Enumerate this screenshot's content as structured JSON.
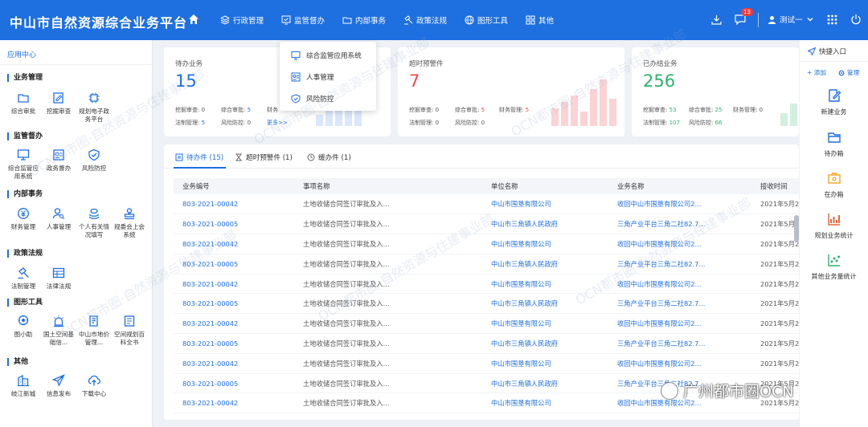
{
  "app": {
    "title": "中山市自然资源综合业务平台"
  },
  "nav": [
    {
      "label": "行政管理",
      "icon": "layers-icon"
    },
    {
      "label": "监管督办",
      "icon": "monitor-check-icon"
    },
    {
      "label": "内部事务",
      "icon": "folder-icon"
    },
    {
      "label": "政策法规",
      "icon": "gavel-icon"
    },
    {
      "label": "图形工具",
      "icon": "globe-icon"
    },
    {
      "label": "其他",
      "icon": "grid-icon"
    }
  ],
  "header": {
    "badge_count": "13",
    "user_name": "测试一"
  },
  "dropdown": {
    "items": [
      "综合监管应用系统",
      "人事管理",
      "风险防控"
    ]
  },
  "sidebar": {
    "title": "应用中心",
    "groups": [
      {
        "title": "业务管理",
        "items": [
          "综合审批",
          "挖掘审查",
          "规划电子政务平台"
        ]
      },
      {
        "title": "监管督办",
        "items": [
          "综合监管应用系统",
          "政务督办",
          "风险防控"
        ]
      },
      {
        "title": "内部事务",
        "items": [
          "财务管理",
          "人事管理",
          "个人有关情况填写",
          "规委会上会系统"
        ]
      },
      {
        "title": "政策法规",
        "items": [
          "法制管理",
          "法律法规"
        ]
      },
      {
        "title": "图形工具",
        "items": [
          "图小助",
          "国土空间基础信...",
          "中山市地价管理...",
          "空间规划百科全书"
        ]
      },
      {
        "title": "其他",
        "items": [
          "岐江新城",
          "信息发布",
          "下载中心"
        ]
      }
    ]
  },
  "cards": [
    {
      "title": "待办业务",
      "value": "15",
      "color": "#1e6fe0",
      "stats": [
        [
          "挖掘审查:",
          "0"
        ],
        [
          "综合审批:",
          "5"
        ],
        [
          "财务",
          ""
        ],
        [
          "法制管理:",
          "5"
        ],
        [
          "风险防控:",
          "0"
        ],
        [
          "更多>>",
          ""
        ]
      ]
    },
    {
      "title": "超时预警件",
      "value": "7",
      "color": "#f0484f",
      "stats": [
        [
          "挖掘审查:",
          "0"
        ],
        [
          "综合审批:",
          "5"
        ],
        [
          "财务管理:",
          "5"
        ],
        [
          "法制管理:",
          "0"
        ],
        [
          "风险防控:",
          "0"
        ],
        [
          "",
          ""
        ]
      ]
    },
    {
      "title": "已办结业务",
      "value": "256",
      "color": "#2cb36b",
      "stats": [
        [
          "挖掘审查:",
          "53"
        ],
        [
          "综合审批:",
          "25"
        ],
        [
          "财务管理:",
          "0"
        ],
        [
          "法制管理:",
          "107"
        ],
        [
          "风险防控:",
          "66"
        ],
        [
          "",
          ""
        ]
      ]
    }
  ],
  "panel": {
    "tabs": [
      "待办件 (15)",
      "超时预警件 (1)",
      "缓办件 (1)"
    ],
    "columns": [
      "业务编号",
      "事项名称",
      "单位名称",
      "业务名称",
      "接收时间"
    ],
    "rows": [
      [
        "803-2021-00042",
        "土地收储合同签订审批及入...",
        "中山市围垦有限公司",
        "收回中山市围垦有限公司2...",
        "2021年5月2"
      ],
      [
        "803-2021-00005",
        "土地收储合同签订审批及入...",
        "中山市三角镇人民政府",
        "三角产业平台三角二社82.7...",
        "2021年5月2"
      ],
      [
        "803-2021-00042",
        "土地收储合同签订审批及入...",
        "中山市围垦有限公司",
        "收回中山市围垦有限公司2...",
        "2021年5月2"
      ],
      [
        "803-2021-00005",
        "土地收储合同签订审批及入...",
        "中山市三角镇人民政府",
        "三角产业平台三角二社82.7...",
        "2021年5月2"
      ],
      [
        "803-2021-00042",
        "土地收储合同签订审批及入...",
        "中山市围垦有限公司",
        "收回中山市围垦有限公司2...",
        "2021年5月2"
      ],
      [
        "803-2021-00005",
        "土地收储合同签订审批及入...",
        "中山市三角镇人民政府",
        "三角产业平台三角二社82.7...",
        "2021年5月2"
      ],
      [
        "803-2021-00042",
        "土地收储合同签订审批及入...",
        "中山市围垦有限公司",
        "收回中山市围垦有限公司2...",
        "2021年5月2"
      ],
      [
        "803-2021-00005",
        "土地收储合同签订审批及入...",
        "中山市三角镇人民政府",
        "三角产业平台三角二社82.7...",
        "2021年5月2"
      ],
      [
        "803-2021-00042",
        "土地收储合同签订审批及入...",
        "中山市围垦有限公司",
        "收回中山市围垦有限公司2...",
        "2021年5月2"
      ],
      [
        "803-2021-00005",
        "土地收储合同签订审批及入...",
        "中山市三角镇人民政府",
        "三角产业平台三角二社82.7...",
        "2021年5月2"
      ],
      [
        "803-2021-00042",
        "土地收储合同签订审批及入...",
        "中山市围垦有限公司",
        "收回中山市围垦有限公司2...",
        "2021年5月2"
      ]
    ]
  },
  "rightbar": {
    "title": "快捷入口",
    "add": "+ 添加",
    "manage": "管理",
    "items": [
      "新建业务",
      "待办箱",
      "在办箱",
      "规划业务统计",
      "其他业务量统计"
    ]
  },
  "watermark": {
    "text": "OCN都市圈·自然资源与住建事业部"
  },
  "footer": {
    "text": "广州都市圈OCN"
  }
}
